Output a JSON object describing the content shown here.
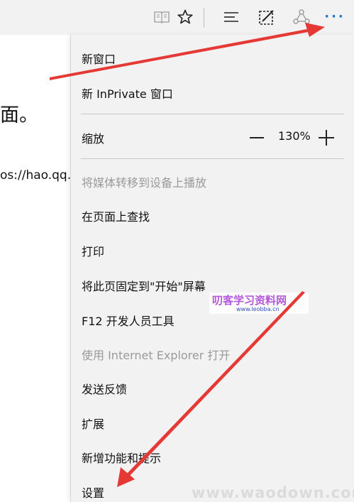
{
  "page": {
    "heading_fragment": "面。",
    "url_fragment": "os://hao.qq.c"
  },
  "toolbar": {
    "icons": [
      "reading-view-icon",
      "favorite-star-icon",
      "hub-icon",
      "web-note-icon",
      "share-icon",
      "more-icon"
    ],
    "more_label": "···",
    "accent_color": "#1e6fd0"
  },
  "menu": {
    "new_window": "新窗口",
    "new_inprivate": "新 InPrivate 窗口",
    "zoom_label": "缩放",
    "zoom_value": "130%",
    "cast": "将媒体转移到设备上播放",
    "find": "在页面上查找",
    "print": "打印",
    "pin_start": "将此页固定到\"开始\"屏幕",
    "devtools": "F12 开发人员工具",
    "open_ie": "使用 Internet Explorer 打开",
    "feedback": "发送反馈",
    "extensions": "扩展",
    "whats_new": "新增功能和提示",
    "settings": "设置"
  },
  "watermarks": {
    "main": "叨客学习资料网",
    "sub": "www.leobba.cn",
    "bottom": "www.waodown.com"
  },
  "annotation_arrow_color": "#e53935"
}
